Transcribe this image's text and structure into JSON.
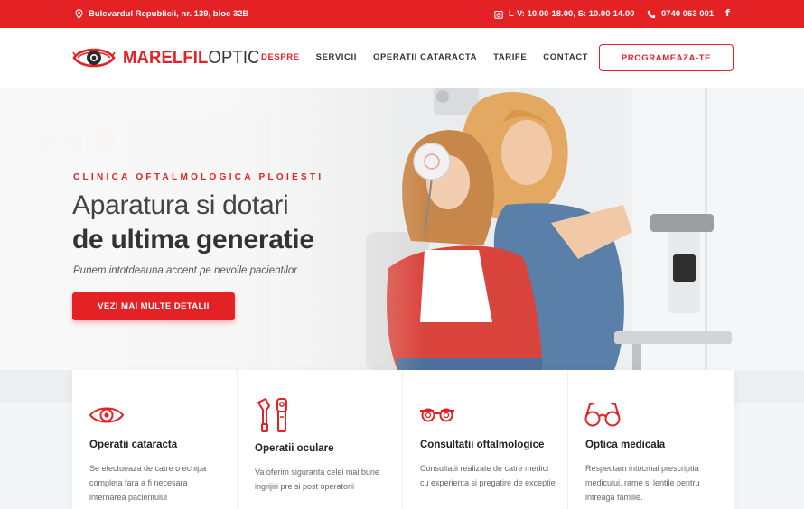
{
  "topbar": {
    "address": "Bulevardul Republicii, nr. 139, bloc 32B",
    "hours": "L-V: 10.00-18.00, S: 10.00-14.00",
    "phone": "0740 063 001",
    "social": "f"
  },
  "header": {
    "logo_part1": "MARELFIL",
    "logo_part2": "OPTIC",
    "nav": [
      "DESPRE",
      "SERVICII",
      "OPERATII CATARACTA",
      "TARIFE",
      "CONTACT"
    ],
    "cta": "PROGRAMEAZA-TE"
  },
  "hero": {
    "kicker": "CLINICA OFTALMOLOGICA PLOIESTI",
    "title_line1": "Aparatura si dotari",
    "title_line2": "de ultima generatie",
    "subtitle": "Punem intotdeauna accent pe nevoile pacientilor",
    "button": "VEZI MAI MULTE DETALII"
  },
  "services": [
    {
      "title": "Operatii cataracta",
      "text": "Se efectueaza de catre o echipa completa fara a fi necesara internarea pacientului",
      "icon": "eye-icon"
    },
    {
      "title": "Operatii oculare",
      "text": "Va oferim siguranta celei mai bune ingrijiri pre si post operatorii",
      "icon": "ophthalmoscope-icon"
    },
    {
      "title": "Consultatii oftalmologice",
      "text": "Consultatii realizate de catre medici cu experienta si pregatire de exceptie",
      "icon": "trial-frame-icon"
    },
    {
      "title": "Optica medicala",
      "text": "Respectam intocmai prescriptia medicului, rame si lentile pentru intreaga familie.",
      "icon": "glasses-icon"
    }
  ],
  "colors": {
    "accent": "#e42125",
    "text": "#333333"
  }
}
